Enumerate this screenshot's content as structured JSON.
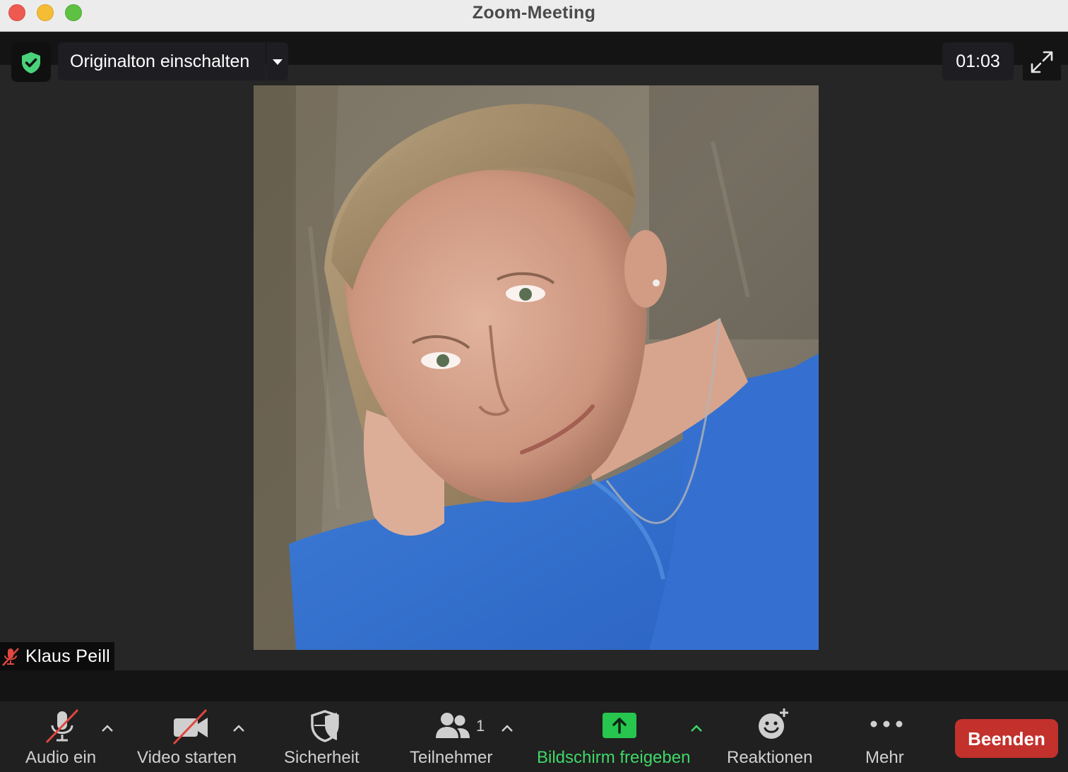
{
  "window": {
    "title": "Zoom-Meeting"
  },
  "top_bar": {
    "security_icon": "shield-check-icon",
    "original_sound_label": "Originalton einschalten",
    "timer": "01:03",
    "fullscreen_icon": "expand-arrows-icon"
  },
  "participant": {
    "name": "Klaus Peill",
    "muted": true
  },
  "toolbar": {
    "audio_label": "Audio ein",
    "video_label": "Video starten",
    "security_label": "Sicherheit",
    "participants_label": "Teilnehmer",
    "participants_count": "1",
    "share_label": "Bildschirm freigeben",
    "reactions_label": "Reaktionen",
    "more_label": "Mehr",
    "end_label": "Beenden"
  },
  "colors": {
    "accent_green": "#4ad27a",
    "share_green": "#27c64e",
    "end_red": "#c3312d",
    "muted_red": "#e0473f"
  }
}
